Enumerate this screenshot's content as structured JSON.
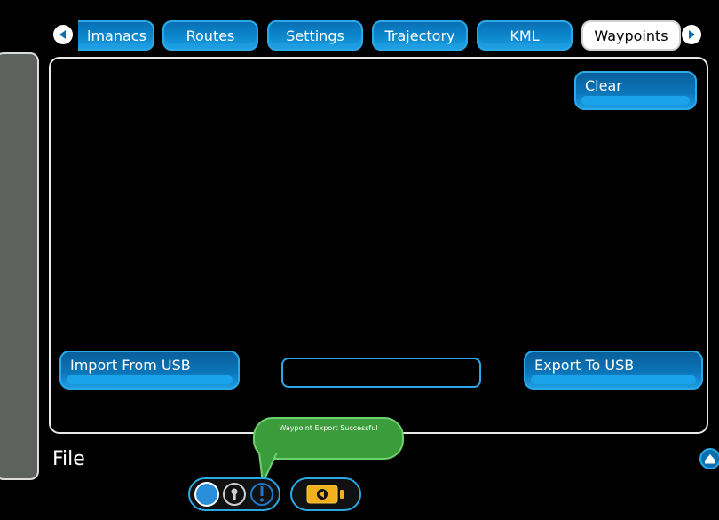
{
  "tabs": [
    {
      "label": "lmanacs",
      "active": false
    },
    {
      "label": "Routes",
      "active": false
    },
    {
      "label": "Settings",
      "active": false
    },
    {
      "label": "Trajectory",
      "active": false
    },
    {
      "label": "KML",
      "active": false
    },
    {
      "label": "Waypoints",
      "active": true
    }
  ],
  "panel": {
    "clear_label": "Clear",
    "import_label": "Import From USB",
    "export_label": "Export To USB",
    "file_field_value": ""
  },
  "section_label": "File",
  "toast": {
    "message": "Waypoint Export Successful"
  },
  "icons": {
    "left": "left-arrow-icon",
    "right": "right-arrow-icon",
    "lock": "lock-icon",
    "alert": "alert-icon",
    "battery": "battery-icon",
    "collapse": "collapse-up-icon"
  },
  "colors": {
    "accent": "#2aa9e6",
    "tab_fill": "#0b84c9",
    "toast": "#3a9c3a",
    "sidebar": "#5d625f",
    "battery": "#f2b01e"
  }
}
